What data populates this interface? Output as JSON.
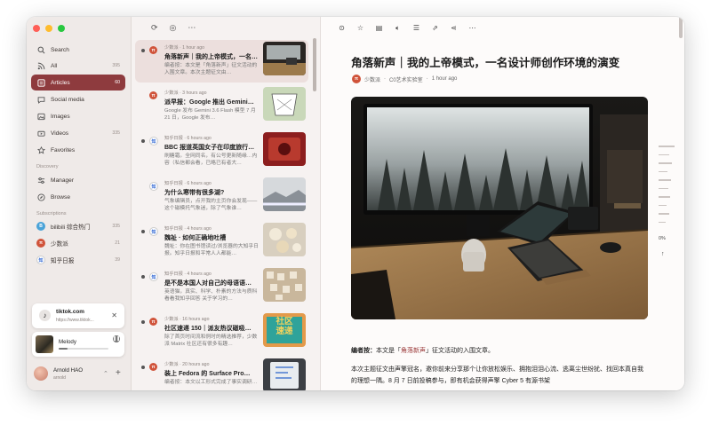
{
  "sidebar": {
    "nav": [
      {
        "label": "Search",
        "count": "",
        "icon": "search-icon"
      },
      {
        "label": "All",
        "count": "395",
        "icon": "rss-icon"
      },
      {
        "label": "Articles",
        "count": "60",
        "icon": "article-icon"
      },
      {
        "label": "Social media",
        "count": "",
        "icon": "chat-bubble-icon"
      },
      {
        "label": "Images",
        "count": "",
        "icon": "image-icon"
      },
      {
        "label": "Videos",
        "count": "335",
        "icon": "video-icon"
      },
      {
        "label": "Favorites",
        "count": "",
        "icon": "star-icon"
      }
    ],
    "discovery_label": "Discovery",
    "discovery": [
      {
        "label": "Manager",
        "icon": "sliders-icon"
      },
      {
        "label": "Browse",
        "icon": "compass-icon"
      }
    ],
    "subscriptions_label": "Subscriptions",
    "subscriptions": [
      {
        "label": "bilibili 综合热门",
        "count": "335",
        "favicon": "B",
        "color": "#4aa3d8"
      },
      {
        "label": "少数派",
        "count": "21",
        "favicon": "π",
        "color": "#d0533a"
      },
      {
        "label": "知乎日报",
        "count": "39",
        "favicon": "知",
        "color": "#ffffff"
      }
    ],
    "notification": {
      "title": "tiktok.com",
      "url": "https://www.tiktok..."
    },
    "player": {
      "title": "Melody",
      "progress": 0.18
    },
    "user": {
      "name": "Arnold HAO",
      "handle": "arnold"
    }
  },
  "list": {
    "items": [
      {
        "source": "少数派 · 1 hour ago",
        "title": "角落新声｜我的上帝模式，一名…",
        "summary": "编者按：本文是「角落新声」征文活动的入围文章。本次主题征文由…",
        "favicon": "π",
        "color": "#d0533a",
        "unread": true,
        "selected": true,
        "thumb": "desk"
      },
      {
        "source": "少数派 · 3 hours ago",
        "title": "派早报：Google 推出 Gemini…",
        "summary": "Google 发布 Gemini 3.6 Flash 模型 7 月 21 日，Google 发布…",
        "favicon": "π",
        "color": "#d0533a",
        "unread": false,
        "selected": false,
        "thumb": "sketch"
      },
      {
        "source": "知乎日报 · 6 hours ago",
        "title": "BBC 报道英国女子在印度旅行…",
        "summary": "刷糖霜。全网同名，有公号更新随缘…内容（私信都会看，已略已有者大…",
        "favicon": "知",
        "color": "#ffffff",
        "unread": true,
        "selected": false,
        "thumb": "red"
      },
      {
        "source": "知乎日报 · 6 hours ago",
        "title": "为什么寒带有很多湖?",
        "summary": "气象编辑员，点开我的主页你会发现——这个磁模托气象迷，除了气象谁…",
        "favicon": "知",
        "color": "#ffffff",
        "unread": false,
        "selected": false,
        "thumb": "snow"
      },
      {
        "source": "知乎日报 · 4 hours ago",
        "title": "魏祉 · 如何正确地吐槽",
        "summary": "魏祉：你在图书馆读过/浏览器的大知乎日报。知乎日报和平常人人都能…",
        "favicon": "知",
        "color": "#ffffff",
        "unread": true,
        "selected": false,
        "thumb": "cookies"
      },
      {
        "source": "知乎日报 · 4 hours ago",
        "title": "是不是本国人对自己的母语语…",
        "summary": "英语猫，真实、科学、朴素的方法与质科 看看我知乎回答 关于学习的…",
        "favicon": "知",
        "color": "#ffffff",
        "unread": true,
        "selected": false,
        "thumb": "letters"
      },
      {
        "source": "少数派 · 16 hours ago",
        "title": "社区速递 150｜派友热议磁吸…",
        "summary": "除了首页时间流和例时的精选推荐，少数派 Matrix 社区还有很多有趣…",
        "favicon": "π",
        "color": "#d0533a",
        "unread": true,
        "selected": false,
        "thumb": "community"
      },
      {
        "source": "少数派 · 20 hours ago",
        "title": "装上 Fedora 的 Surface Pro…",
        "summary": "编者按：本文以工形式完成了事实调研…",
        "favicon": "π",
        "color": "#d0533a",
        "unread": true,
        "selected": false,
        "thumb": "tablet"
      }
    ],
    "community_badge": "社区\n速递"
  },
  "reader": {
    "title": "角落新声｜我的上帝模式，一名设计师创作环境的演变",
    "author": "少数派",
    "author_favicon": "π",
    "channel": "C0艺术实验室",
    "time": "1 hour ago",
    "lead_label": "编者按：",
    "lead_pre": "本文是「",
    "lead_link": "角落新声",
    "lead_post": "」征文活动的入围文章。",
    "body": "本次主题征文由声擎冠名，邀你前来分享那个让你放松娱乐、拥抱泪泪心流、逃离尘世纷扰、找回本真自我的理想一隅。8 月 7 日前投稿参与，即有机会获得声擎 Cyber 5 有源书架",
    "progress_label": "0%"
  },
  "colors": {
    "accent": "#8e3b3e",
    "sspai": "#d0533a"
  }
}
